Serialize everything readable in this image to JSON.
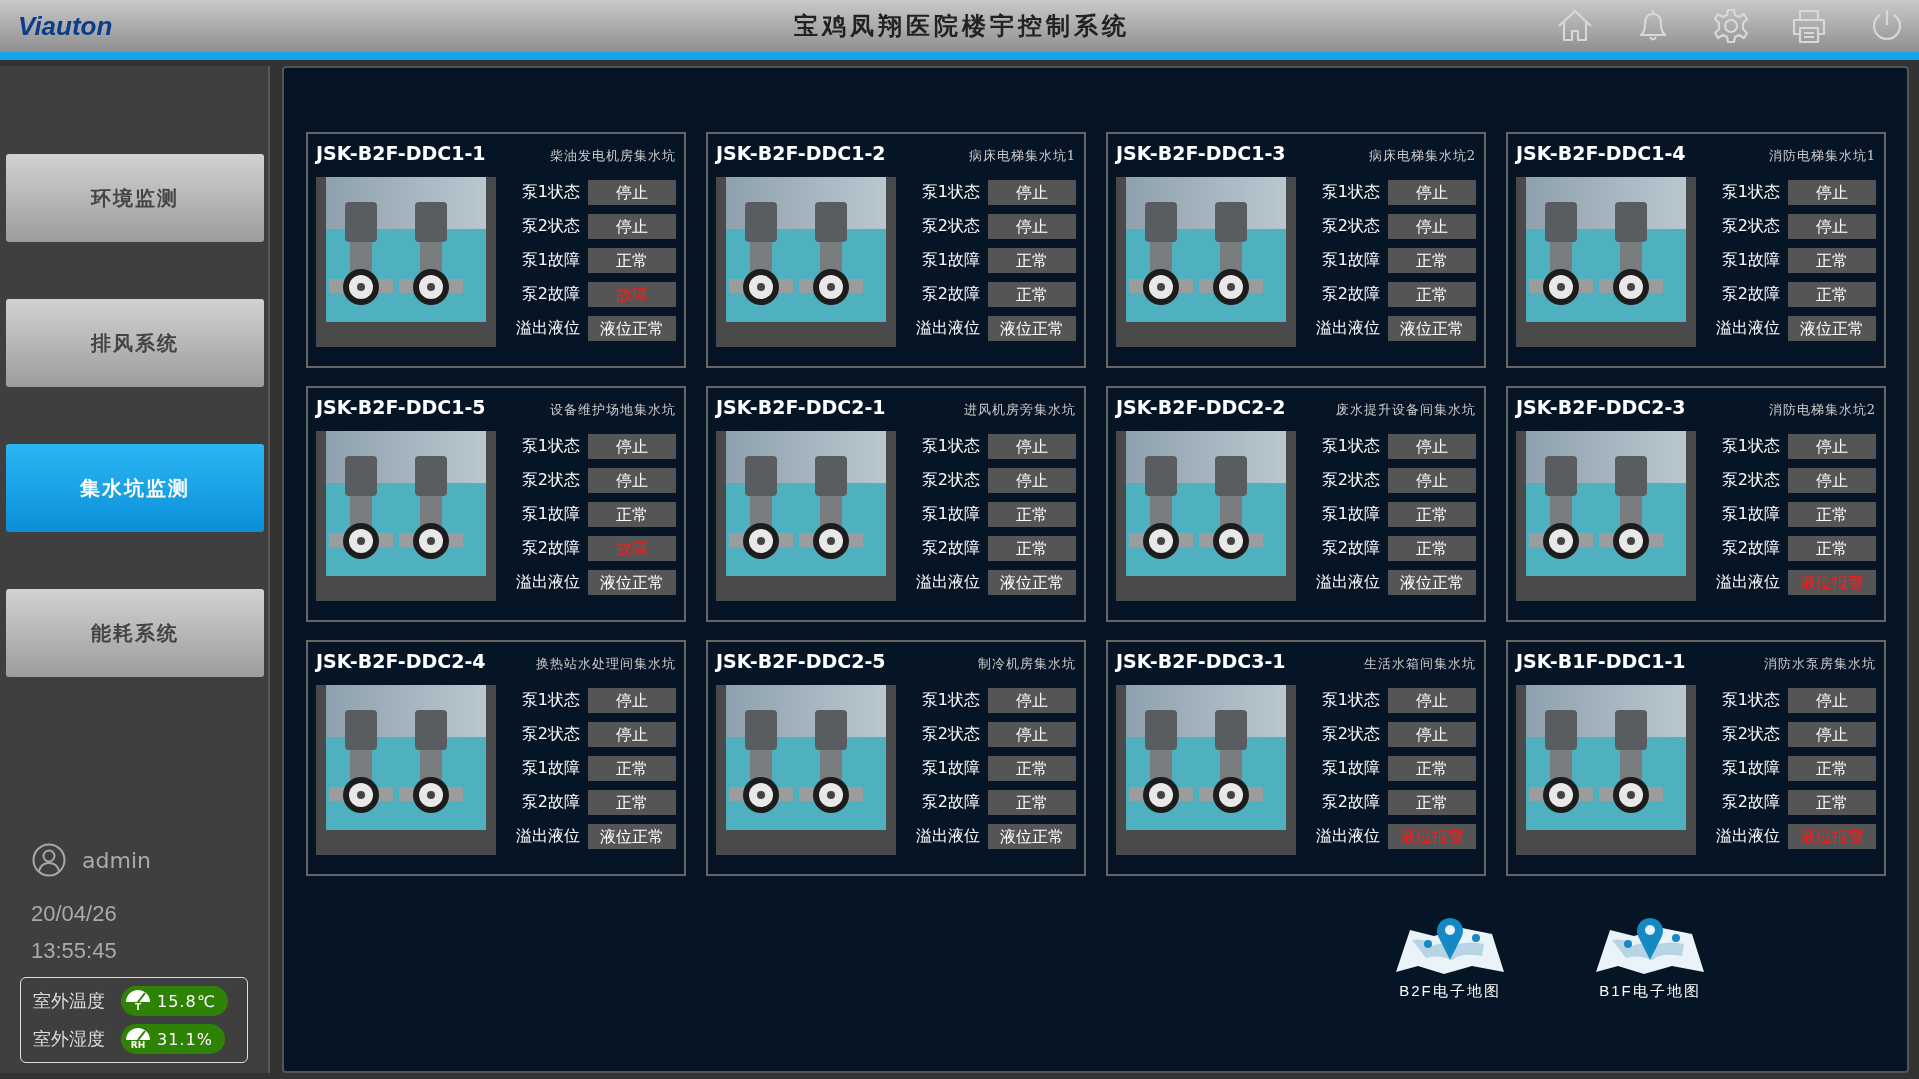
{
  "header": {
    "logo": "Viauton",
    "title": "宝鸡凤翔医院楼宇控制系统"
  },
  "sidebar": {
    "items": [
      {
        "label": "环境监测",
        "selected": false
      },
      {
        "label": "排风系统",
        "selected": false
      },
      {
        "label": "集水坑监测",
        "selected": true
      },
      {
        "label": "能耗系统",
        "selected": false
      }
    ],
    "user": "admin",
    "date": "20/04/26",
    "time": "13:55:45",
    "weather": [
      {
        "label": "室外温度",
        "badge": "T",
        "value": "15.8℃"
      },
      {
        "label": "室外湿度",
        "badge": "RH",
        "value": "31.1%"
      }
    ]
  },
  "pits": [
    {
      "id": "JSK-B2F-DDC1-1",
      "location": "柴油发电机房集水坑",
      "rows": [
        {
          "label": "泵1状态",
          "value": "停止",
          "alarm": false
        },
        {
          "label": "泵2状态",
          "value": "停止",
          "alarm": false
        },
        {
          "label": "泵1故障",
          "value": "正常",
          "alarm": false
        },
        {
          "label": "泵2故障",
          "value": "故障",
          "alarm": true
        },
        {
          "label": "溢出液位",
          "value": "液位正常",
          "alarm": false
        }
      ]
    },
    {
      "id": "JSK-B2F-DDC1-2",
      "location": "病床电梯集水坑1",
      "rows": [
        {
          "label": "泵1状态",
          "value": "停止",
          "alarm": false
        },
        {
          "label": "泵2状态",
          "value": "停止",
          "alarm": false
        },
        {
          "label": "泵1故障",
          "value": "正常",
          "alarm": false
        },
        {
          "label": "泵2故障",
          "value": "正常",
          "alarm": false
        },
        {
          "label": "溢出液位",
          "value": "液位正常",
          "alarm": false
        }
      ]
    },
    {
      "id": "JSK-B2F-DDC1-3",
      "location": "病床电梯集水坑2",
      "rows": [
        {
          "label": "泵1状态",
          "value": "停止",
          "alarm": false
        },
        {
          "label": "泵2状态",
          "value": "停止",
          "alarm": false
        },
        {
          "label": "泵1故障",
          "value": "正常",
          "alarm": false
        },
        {
          "label": "泵2故障",
          "value": "正常",
          "alarm": false
        },
        {
          "label": "溢出液位",
          "value": "液位正常",
          "alarm": false
        }
      ]
    },
    {
      "id": "JSK-B2F-DDC1-4",
      "location": "消防电梯集水坑1",
      "rows": [
        {
          "label": "泵1状态",
          "value": "停止",
          "alarm": false
        },
        {
          "label": "泵2状态",
          "value": "停止",
          "alarm": false
        },
        {
          "label": "泵1故障",
          "value": "正常",
          "alarm": false
        },
        {
          "label": "泵2故障",
          "value": "正常",
          "alarm": false
        },
        {
          "label": "溢出液位",
          "value": "液位正常",
          "alarm": false
        }
      ]
    },
    {
      "id": "JSK-B2F-DDC1-5",
      "location": "设备维护场地集水坑",
      "rows": [
        {
          "label": "泵1状态",
          "value": "停止",
          "alarm": false
        },
        {
          "label": "泵2状态",
          "value": "停止",
          "alarm": false
        },
        {
          "label": "泵1故障",
          "value": "正常",
          "alarm": false
        },
        {
          "label": "泵2故障",
          "value": "故障",
          "alarm": true
        },
        {
          "label": "溢出液位",
          "value": "液位正常",
          "alarm": false
        }
      ]
    },
    {
      "id": "JSK-B2F-DDC2-1",
      "location": "进风机房旁集水坑",
      "rows": [
        {
          "label": "泵1状态",
          "value": "停止",
          "alarm": false
        },
        {
          "label": "泵2状态",
          "value": "停止",
          "alarm": false
        },
        {
          "label": "泵1故障",
          "value": "正常",
          "alarm": false
        },
        {
          "label": "泵2故障",
          "value": "正常",
          "alarm": false
        },
        {
          "label": "溢出液位",
          "value": "液位正常",
          "alarm": false
        }
      ]
    },
    {
      "id": "JSK-B2F-DDC2-2",
      "location": "废水提升设备间集水坑",
      "rows": [
        {
          "label": "泵1状态",
          "value": "停止",
          "alarm": false
        },
        {
          "label": "泵2状态",
          "value": "停止",
          "alarm": false
        },
        {
          "label": "泵1故障",
          "value": "正常",
          "alarm": false
        },
        {
          "label": "泵2故障",
          "value": "正常",
          "alarm": false
        },
        {
          "label": "溢出液位",
          "value": "液位正常",
          "alarm": false
        }
      ]
    },
    {
      "id": "JSK-B2F-DDC2-3",
      "location": "消防电梯集水坑2",
      "rows": [
        {
          "label": "泵1状态",
          "value": "停止",
          "alarm": false
        },
        {
          "label": "泵2状态",
          "value": "停止",
          "alarm": false
        },
        {
          "label": "泵1故障",
          "value": "正常",
          "alarm": false
        },
        {
          "label": "泵2故障",
          "value": "正常",
          "alarm": false
        },
        {
          "label": "溢出液位",
          "value": "液位报警",
          "alarm": true
        }
      ]
    },
    {
      "id": "JSK-B2F-DDC2-4",
      "location": "换热站水处理间集水坑",
      "rows": [
        {
          "label": "泵1状态",
          "value": "停止",
          "alarm": false
        },
        {
          "label": "泵2状态",
          "value": "停止",
          "alarm": false
        },
        {
          "label": "泵1故障",
          "value": "正常",
          "alarm": false
        },
        {
          "label": "泵2故障",
          "value": "正常",
          "alarm": false
        },
        {
          "label": "溢出液位",
          "value": "液位正常",
          "alarm": false
        }
      ]
    },
    {
      "id": "JSK-B2F-DDC2-5",
      "location": "制冷机房集水坑",
      "rows": [
        {
          "label": "泵1状态",
          "value": "停止",
          "alarm": false
        },
        {
          "label": "泵2状态",
          "value": "停止",
          "alarm": false
        },
        {
          "label": "泵1故障",
          "value": "正常",
          "alarm": false
        },
        {
          "label": "泵2故障",
          "value": "正常",
          "alarm": false
        },
        {
          "label": "溢出液位",
          "value": "液位正常",
          "alarm": false
        }
      ]
    },
    {
      "id": "JSK-B2F-DDC3-1",
      "location": "生活水箱间集水坑",
      "rows": [
        {
          "label": "泵1状态",
          "value": "停止",
          "alarm": false
        },
        {
          "label": "泵2状态",
          "value": "停止",
          "alarm": false
        },
        {
          "label": "泵1故障",
          "value": "正常",
          "alarm": false
        },
        {
          "label": "泵2故障",
          "value": "正常",
          "alarm": false
        },
        {
          "label": "溢出液位",
          "value": "液位报警",
          "alarm": true
        }
      ]
    },
    {
      "id": "JSK-B1F-DDC1-1",
      "location": "消防水泵房集水坑",
      "rows": [
        {
          "label": "泵1状态",
          "value": "停止",
          "alarm": false
        },
        {
          "label": "泵2状态",
          "value": "停止",
          "alarm": false
        },
        {
          "label": "泵1故障",
          "value": "正常",
          "alarm": false
        },
        {
          "label": "泵2故障",
          "value": "正常",
          "alarm": false
        },
        {
          "label": "溢出液位",
          "value": "液位报警",
          "alarm": true
        }
      ]
    }
  ],
  "maps": [
    {
      "label": "B2F电子地图"
    },
    {
      "label": "B1F电子地图"
    }
  ]
}
